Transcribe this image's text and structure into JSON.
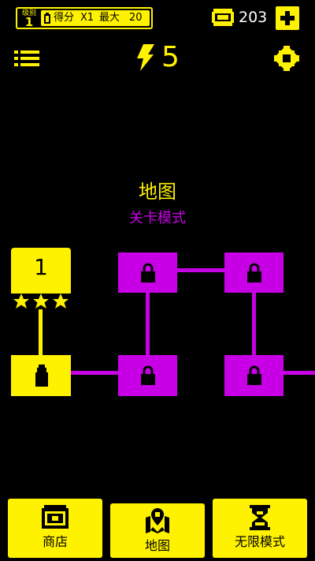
{
  "header": {
    "level_label": "级别",
    "level_value": "1",
    "score_label": "得分",
    "score_multiplier": "X1",
    "max_label": "最大",
    "max_value": "20",
    "coins": "203"
  },
  "energy": {
    "count": "5"
  },
  "map": {
    "title": "地图",
    "subtitle": "关卡模式",
    "current_level": "1",
    "current_level_stars": 3,
    "nodes": [
      {
        "id": "level-1",
        "state": "unlocked",
        "label": "1"
      },
      {
        "id": "node-top-2",
        "state": "locked"
      },
      {
        "id": "node-top-3",
        "state": "locked"
      },
      {
        "id": "node-bottom-1",
        "state": "current-item"
      },
      {
        "id": "node-bottom-2",
        "state": "locked"
      },
      {
        "id": "node-bottom-3",
        "state": "locked"
      }
    ]
  },
  "bottom_nav": {
    "shop_label": "商店",
    "map_label": "地图",
    "endless_label": "无限模式"
  },
  "colors": {
    "background": "#000000",
    "accent_yellow": "#fff200",
    "locked_purple": "#c800e6"
  },
  "icons": [
    "battery-icon",
    "coin-icon",
    "plus-icon",
    "menu-icon",
    "lightning-icon",
    "gear-icon",
    "lock-icon",
    "star-icon",
    "bottle-icon",
    "chest-icon",
    "map-pin-icon",
    "hourglass-icon"
  ]
}
